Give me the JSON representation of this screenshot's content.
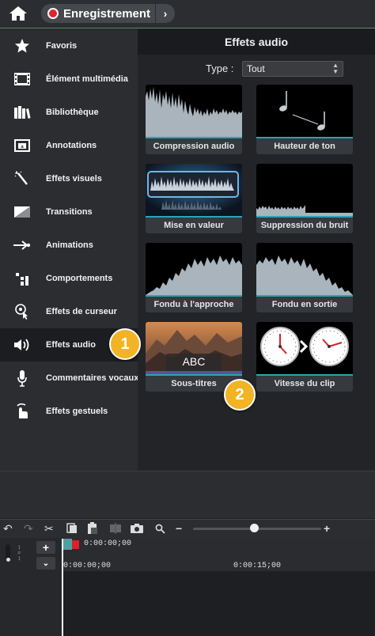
{
  "topbar": {
    "record_label": "Enregistrement",
    "icons": [
      "home-icon",
      "record-dot-icon",
      "chevron-right-icon"
    ]
  },
  "sidebar": {
    "items": [
      {
        "label": "Favoris",
        "icon": "star-icon"
      },
      {
        "label": "Élément multimédia",
        "icon": "film-icon"
      },
      {
        "label": "Bibliothèque",
        "icon": "library-icon"
      },
      {
        "label": "Annotations",
        "icon": "annotation-icon"
      },
      {
        "label": "Effets visuels",
        "icon": "magic-wand-icon"
      },
      {
        "label": "Transitions",
        "icon": "transition-icon"
      },
      {
        "label": "Animations",
        "icon": "animation-arrow-icon"
      },
      {
        "label": "Comportements",
        "icon": "behaviors-icon"
      },
      {
        "label": "Effets de curseur",
        "icon": "cursor-icon"
      },
      {
        "label": "Effets audio",
        "icon": "speaker-icon",
        "active": true
      },
      {
        "label": "Commentaires vocaux",
        "icon": "microphone-icon"
      },
      {
        "label": "Effets gestuels",
        "icon": "hand-gesture-icon"
      }
    ]
  },
  "panel": {
    "title": "Effets audio",
    "type_label": "Type :",
    "type_value": "Tout",
    "effects": [
      {
        "label": "Compression audio"
      },
      {
        "label": "Hauteur de ton"
      },
      {
        "label": "Mise en valeur"
      },
      {
        "label": "Suppression du bruit"
      },
      {
        "label": "Fondu à l'approche"
      },
      {
        "label": "Fondu en sortie"
      },
      {
        "label": "Sous-titres",
        "overlay": "ABC"
      },
      {
        "label": "Vitesse du clip"
      }
    ]
  },
  "badges": {
    "one": "1",
    "two": "2"
  },
  "timeline": {
    "playhead_time": "0:00:00;00",
    "ruler_start": "0:00:00;00",
    "ruler_mid": "0:00:15;00",
    "zoom_minus": "−",
    "zoom_plus": "+",
    "zoom_level": 0.45,
    "track_add": "+",
    "track_menu": "⌄"
  }
}
